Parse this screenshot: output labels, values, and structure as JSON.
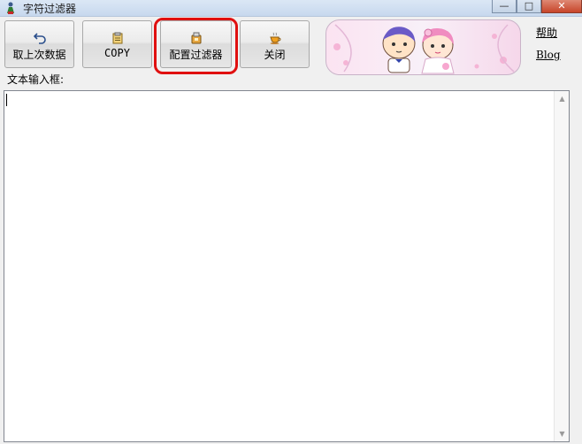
{
  "window": {
    "title": "字符过滤器",
    "minimize_glyph": "—",
    "maximize_glyph": "□",
    "close_glyph": "✕"
  },
  "toolbar": {
    "buttons": [
      {
        "label": "取上次数据",
        "icon": "undo-arrow-icon"
      },
      {
        "label": "COPY",
        "icon": "clipboard-icon"
      },
      {
        "label": "配置过滤器",
        "icon": "gear-box-icon"
      },
      {
        "label": "关闭",
        "icon": "coffee-cup-icon"
      }
    ]
  },
  "banner": {
    "icon": "wedding-couple-cartoon"
  },
  "links": {
    "help": "帮助",
    "blog": "Blog"
  },
  "input": {
    "label": "文本输入框:",
    "value": ""
  },
  "colors": {
    "highlight": "#e01010",
    "banner_pink": "#f8d6ea"
  }
}
